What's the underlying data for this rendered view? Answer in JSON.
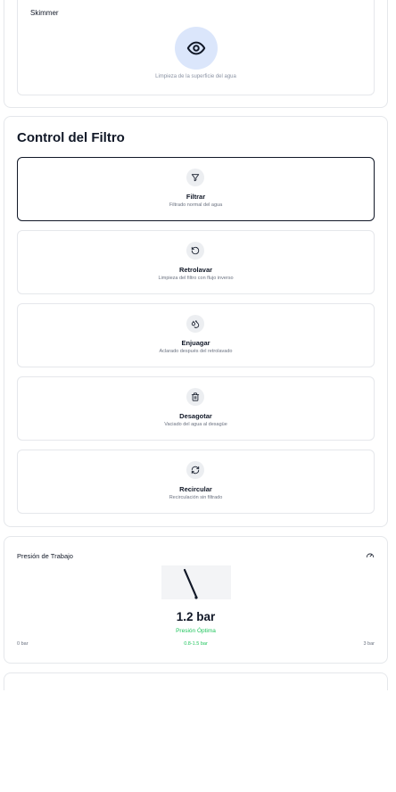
{
  "skimmer": {
    "title": "Skimmer",
    "icon": "eye-icon",
    "description": "Limpieza de la superficie del agua"
  },
  "filter_control": {
    "title": "Control del Filtro",
    "options": [
      {
        "label": "Filtrar",
        "description": "Filtrado normal del agua",
        "icon": "filter-icon",
        "selected": true
      },
      {
        "label": "Retrolavar",
        "description": "Limpieza del filtro con flujo inverso",
        "icon": "rotate-ccw-icon",
        "selected": false
      },
      {
        "label": "Enjuagar",
        "description": "Aclarado después del retrolavado",
        "icon": "droplets-icon",
        "selected": false
      },
      {
        "label": "Desagotar",
        "description": "Vaciado del agua al desagüe",
        "icon": "trash-icon",
        "selected": false
      },
      {
        "label": "Recircular",
        "description": "Recirculación sin filtrado",
        "icon": "refresh-icon",
        "selected": false
      }
    ]
  },
  "pressure": {
    "title": "Presión de Trabajo",
    "icon": "gauge-icon",
    "value": "1.2 bar",
    "status": "Presión Óptima",
    "range": "0.8-1.5 bar",
    "min_label": "0 bar",
    "max_label": "3 bar",
    "status_color": "#22c55e"
  }
}
